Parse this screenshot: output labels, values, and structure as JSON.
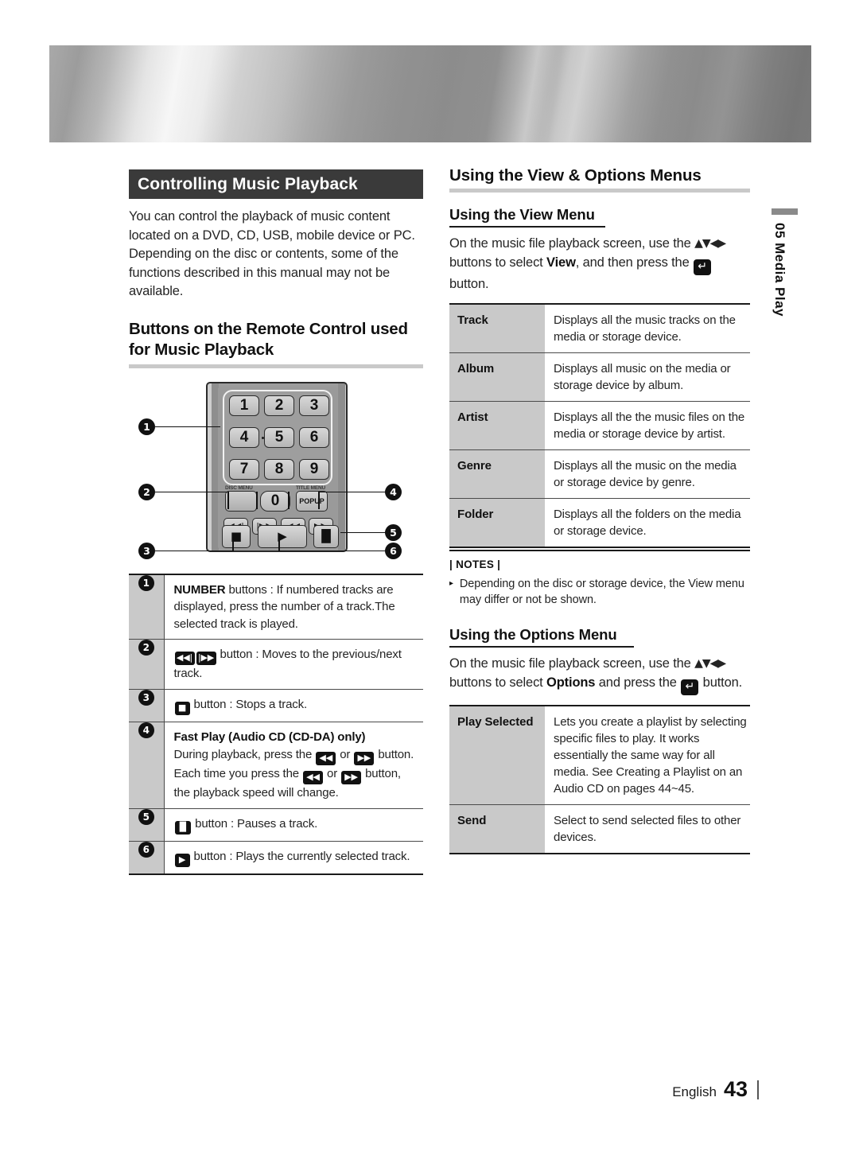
{
  "header": {
    "banner_alt": "metallic-banner"
  },
  "left": {
    "section_title": "Controlling Music Playback",
    "intro": "You can control the playback of music content located on a DVD, CD, USB, mobile device or PC. Depending on the disc or contents, some of the functions described in this manual may not be available.",
    "remote_heading": "Buttons on the Remote Control used for Music Playback",
    "remote": {
      "keys": [
        "1",
        "2",
        "3",
        "4",
        "5",
        "6",
        "7",
        "8",
        "9",
        "0"
      ],
      "disc_menu_label": "DISC MENU",
      "title_menu_label": "TITLE MENU",
      "popup_label": "POPUP",
      "transport": [
        "prev",
        "next",
        "rew",
        "ff"
      ],
      "bottom": [
        "stop",
        "play",
        "pause"
      ],
      "callouts": [
        "1",
        "2",
        "3",
        "4",
        "5",
        "6"
      ]
    },
    "legend": [
      {
        "num": "1",
        "bold_lead": "NUMBER",
        "text": " buttons : If numbered tracks are displayed, press the number of a track.The selected track is played."
      },
      {
        "num": "2",
        "icons": [
          "prev",
          "next"
        ],
        "text": "button : Moves to the previous/next track."
      },
      {
        "num": "3",
        "icons": [
          "stop"
        ],
        "text": "button : Stops a track."
      },
      {
        "num": "4",
        "subtitle": "Fast Play (Audio CD (CD-DA) only)",
        "line1_a": "During playback, press the ",
        "line1_b": " or ",
        "line1_c": " button.",
        "line2_a": "Each time you press the ",
        "line2_b": " or ",
        "line2_c": " button, the playback speed will change."
      },
      {
        "num": "5",
        "icons": [
          "pause"
        ],
        "text": "button : Pauses a track."
      },
      {
        "num": "6",
        "icons": [
          "play"
        ],
        "text": "button : Plays the currently selected track."
      }
    ]
  },
  "right": {
    "section_title": "Using the View & Options Menus",
    "view_menu": {
      "heading": "Using the View Menu",
      "intro_a": "On the music file playback screen, use the ",
      "intro_b": " buttons to select ",
      "intro_bold": "View",
      "intro_c": ", and then press the ",
      "intro_d": " button.",
      "rows": [
        {
          "label": "Track",
          "desc": "Displays all the music tracks on the media or storage device."
        },
        {
          "label": "Album",
          "desc": "Displays all music on the media or storage device by album."
        },
        {
          "label": "Artist",
          "desc": "Displays all the the music files on the media or storage device by artist."
        },
        {
          "label": "Genre",
          "desc": "Displays all the music on the media or storage device by genre."
        },
        {
          "label": "Folder",
          "desc": "Displays all the folders on the media or storage device."
        }
      ]
    },
    "notes": {
      "label": "| NOTES |",
      "items": [
        "Depending on the disc or storage device, the View menu may differ or not be shown."
      ]
    },
    "options_menu": {
      "heading": "Using the Options Menu",
      "intro_a": "On the music file playback screen, use the ",
      "intro_b": " buttons to select ",
      "intro_bold": "Options",
      "intro_c": " and press the ",
      "intro_d": " button.",
      "rows": [
        {
          "label": "Play Selected",
          "desc": "Lets you create a playlist by selecting specific files to play. It works essentially the same way for all media. See Creating a Playlist on an Audio CD on pages 44~45."
        },
        {
          "label": "Send",
          "desc": "Select to send selected files to other devices."
        }
      ]
    }
  },
  "side_tab": {
    "number": "05",
    "label": "Media Play",
    "combined": "05  Media Play"
  },
  "footer": {
    "language": "English",
    "page": "43"
  },
  "glyphs": {
    "prev": "◀◀|",
    "next": "|▶▶",
    "rew": "◀◀",
    "ff": "▶▶",
    "stop": "■",
    "play": "▶",
    "pause": "▐▌",
    "enter": "↵",
    "dpad": "▲▼◀▶",
    "note_tri": "▸"
  },
  "colors": {
    "title_bar_bg": "#3a3a3a",
    "table_label_bg": "#c9c9c9",
    "rule_gray": "#c9c9c9",
    "ink": "#1a1a1a"
  }
}
